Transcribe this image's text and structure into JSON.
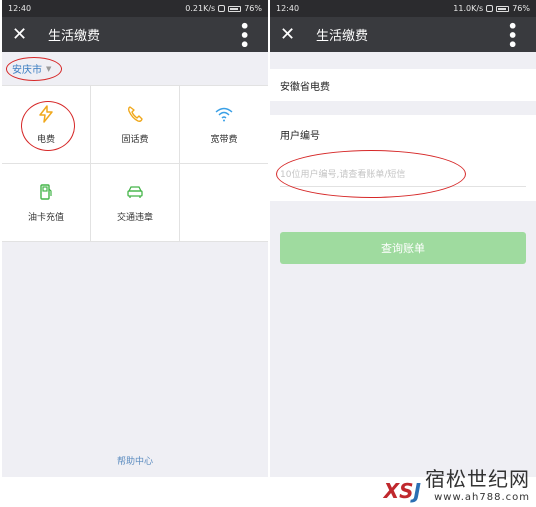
{
  "left": {
    "status": {
      "time": "12:40",
      "speed": "0.21K/s",
      "battery": "76%"
    },
    "title": "生活缴费",
    "city": "安庆市",
    "services": [
      {
        "label": "电费",
        "icon": "lightning-icon",
        "color": "#f0a81c"
      },
      {
        "label": "固话费",
        "icon": "phone-icon",
        "color": "#f0a81c"
      },
      {
        "label": "宽带费",
        "icon": "wifi-icon",
        "color": "#3aa0e6"
      },
      {
        "label": "油卡充值",
        "icon": "gas-pump-icon",
        "color": "#44b549"
      },
      {
        "label": "交通违章",
        "icon": "car-icon",
        "color": "#44b549"
      }
    ],
    "help": "帮助中心"
  },
  "right": {
    "status": {
      "time": "12:40",
      "speed": "11.0K/s",
      "battery": "76%"
    },
    "title": "生活缴费",
    "provider": "安徽省电费",
    "user_label": "用户编号",
    "input_placeholder": "10位用户编号,请查看账单/短信",
    "query_button": "查询账单"
  },
  "watermark": {
    "logo": "XSJ",
    "name": "宿松世纪网",
    "url": "www.ah788.com"
  },
  "colors": {
    "titlebar": "#393a3e",
    "accent_green": "#9fdb9f",
    "highlight_red": "#d62828"
  }
}
